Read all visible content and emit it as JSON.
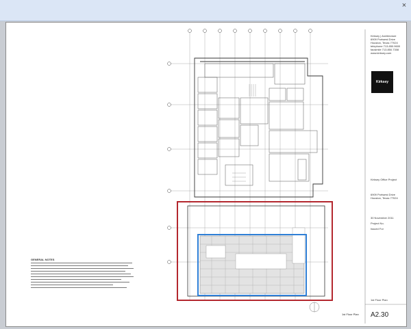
{
  "window": {
    "close_glyph": "×"
  },
  "title_block": {
    "firm_lines": [
      "Kirksey | Architecture",
      "6909 Portwest Drive",
      "Houston, Texas 77024",
      "telephone 713.850.9600",
      "facsimile 713.850.7308",
      "www.kirksey.com"
    ],
    "logo_text": "Kirksey",
    "project_name": "Kirksey Office Project",
    "project_address": [
      "6909 Portwest Drive",
      "Houston, Texas 77024"
    ],
    "date": "30 November 2011",
    "project_no": "Project No.",
    "issued_for": "Issued For",
    "sheet_title": "1st Floor Plan",
    "sheet_number": "A2.30",
    "label_floor_plan": "1st Floor Plan"
  },
  "notes": {
    "title": "GENERAL NOTES"
  },
  "colors": {
    "highlight_red": "#b3262d",
    "highlight_blue": "#2f7fd6"
  }
}
